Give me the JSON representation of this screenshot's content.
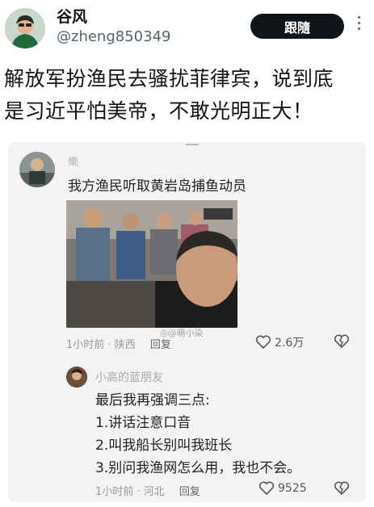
{
  "header": {
    "display_name": "谷风",
    "handle": "@zheng850349",
    "follow_label": "跟隨",
    "more_icon": "more-vertical-icon"
  },
  "tweet": {
    "line1": "解放军扮渔民去骚扰菲律宾，说到底",
    "line2": "是习近平怕美帝，不敢光明正大！"
  },
  "embedded_post": {
    "username": "樂",
    "text": "我方渔民听取黄岩岛捕鱼动员",
    "time": "1小时前 · 陕西",
    "reply_label": "回复",
    "likes": "2.6万",
    "watermark": "◎@萌小染",
    "reply": {
      "username": "小高的蓝朋友",
      "lines": [
        "最后我再强调三点:",
        "1.讲话注意口音",
        "2.叫我船长别叫我班长",
        "3.别问我渔网怎么用，我也不会。"
      ],
      "time": "1小时前 · 河北",
      "reply_label": "回复",
      "likes": "9525"
    }
  },
  "colors": {
    "follow_bg": "#0f1419",
    "handle": "#536471",
    "card_bg": "#f3f3f3"
  }
}
